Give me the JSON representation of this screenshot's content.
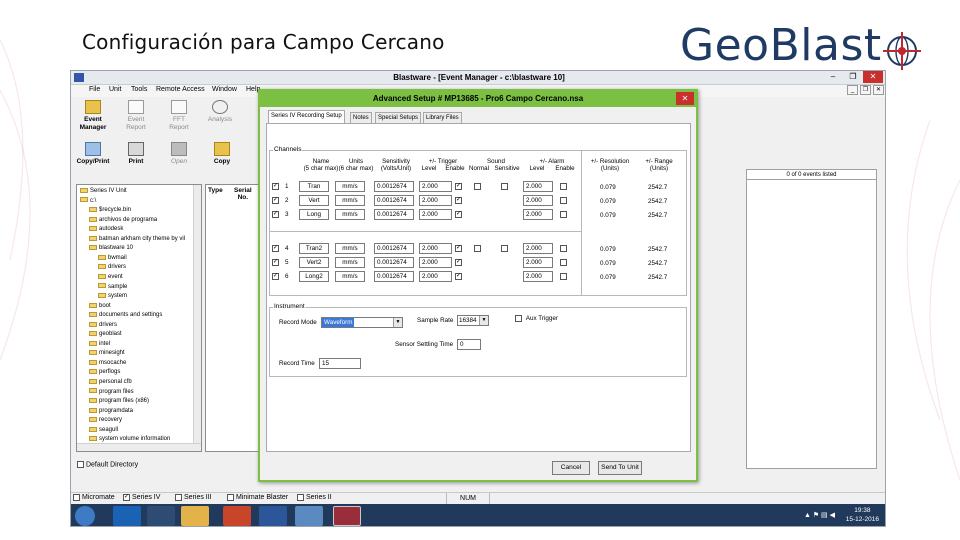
{
  "slide": {
    "title": "Configuración para Campo Cercano",
    "logo_text": "GeoBlast",
    "logo_icon": "globe-crosshair-icon",
    "colors": {
      "logo_blue": "#1f3b63",
      "logo_red": "#c0282d",
      "dialog_green": "#7cc043"
    }
  },
  "app": {
    "title": "Blastware - [Event Manager - c:\\blastware 10]",
    "window_buttons": [
      "–",
      "❐",
      "✕"
    ],
    "inner_buttons": [
      "_",
      "❐",
      "✕"
    ],
    "menu": [
      "File",
      "Unit",
      "Tools",
      "Remote Access",
      "Window",
      "Help"
    ],
    "toolbar_row1": [
      {
        "label": "Event\nManager",
        "icon": "folder-icon",
        "enabled": true
      },
      {
        "label": "Event\nReport",
        "icon": "report-icon",
        "enabled": false
      },
      {
        "label": "FFT\nReport",
        "icon": "fft-icon",
        "enabled": false
      },
      {
        "label": "Analysis",
        "icon": "analysis-icon",
        "enabled": false
      }
    ],
    "toolbar_row2": [
      {
        "label": "Copy/Print",
        "icon": "copy-print-icon",
        "enabled": true
      },
      {
        "label": "Print",
        "icon": "print-icon",
        "enabled": true
      },
      {
        "label": "Open",
        "icon": "open-icon",
        "enabled": false
      },
      {
        "label": "Copy",
        "icon": "copy-icon",
        "enabled": true
      }
    ],
    "tree": [
      {
        "label": "Series IV Unit",
        "level": 0
      },
      {
        "label": "c:\\",
        "level": 0
      },
      {
        "label": "$recycle.bin",
        "level": 1
      },
      {
        "label": "archivos de programa",
        "level": 1
      },
      {
        "label": "autodesk",
        "level": 1
      },
      {
        "label": "batman arkham city theme by vil",
        "level": 1
      },
      {
        "label": "blastware 10",
        "level": 1
      },
      {
        "label": "bwmail",
        "level": 2
      },
      {
        "label": "drivers",
        "level": 2
      },
      {
        "label": "event",
        "level": 2
      },
      {
        "label": "sample",
        "level": 2
      },
      {
        "label": "system",
        "level": 2
      },
      {
        "label": "boot",
        "level": 1
      },
      {
        "label": "documents and settings",
        "level": 1
      },
      {
        "label": "drivers",
        "level": 1
      },
      {
        "label": "geoblast",
        "level": 1
      },
      {
        "label": "intel",
        "level": 1
      },
      {
        "label": "minesight",
        "level": 1
      },
      {
        "label": "msocache",
        "level": 1
      },
      {
        "label": "perflogs",
        "level": 1
      },
      {
        "label": "personal cfb",
        "level": 1
      },
      {
        "label": "program files",
        "level": 1
      },
      {
        "label": "program files (x86)",
        "level": 1
      },
      {
        "label": "programdata",
        "level": 1
      },
      {
        "label": "recovery",
        "level": 1
      },
      {
        "label": "seagull",
        "level": 1
      },
      {
        "label": "system volume information",
        "level": 1
      }
    ],
    "events_header": [
      "Type",
      "Serial\nNo."
    ],
    "events_count": "0 of 0 events listed",
    "default_directory": "Default Directory",
    "status": {
      "items": [
        {
          "label": "Micromate",
          "checked": false
        },
        {
          "label": "Series IV",
          "checked": true
        },
        {
          "label": "Series III",
          "checked": false
        },
        {
          "label": "Minimate Blaster",
          "checked": false
        },
        {
          "label": "Series II",
          "checked": false
        }
      ],
      "num": "NUM"
    },
    "taskbar": {
      "icons": [
        "start-icon",
        "outlook-icon",
        "chrome-icon",
        "explorer-icon",
        "powerpoint-icon",
        "word-icon",
        "app-icon",
        "blastware-icon"
      ],
      "time": "19:38",
      "date": "15-12-2016",
      "tray": "▲ ⚑ ▤ ◀"
    }
  },
  "dialog": {
    "title": "Advanced Setup  # MP13685 - Pro6 Campo Cercano.nsa",
    "close": "✕",
    "tabs": [
      "Series IV Recording Setup",
      "Notes",
      "Special Setups",
      "Library Files"
    ],
    "channels_label": "Channels",
    "headers": {
      "name": "Name\n(5 char max)",
      "units": "Units\n(6 char max)",
      "sensitivity": "Sensitivity\n(Volts/Unit)",
      "trigger": "+/- Trigger",
      "trigger_sub": [
        "Level",
        "Enable"
      ],
      "sound": "Sound",
      "sound_sub": [
        "Normal",
        "Sensitive"
      ],
      "alarm": "+/- Alarm",
      "alarm_sub": [
        "Level",
        "Enable"
      ],
      "resolution": "+/- Resolution\n(Units)",
      "range": "+/- Range\n(Units)"
    },
    "channels": [
      {
        "checked": true,
        "num": "1",
        "name": "Tran",
        "units": "mm/s",
        "sens": "0.0012674",
        "trig": "2.000",
        "trig_en": true,
        "sound": true,
        "alarm": "2.000",
        "res": "0.079",
        "range": "2542.7"
      },
      {
        "checked": true,
        "num": "2",
        "name": "Vert",
        "units": "mm/s",
        "sens": "0.0012674",
        "trig": "2.000",
        "trig_en": true,
        "sound": false,
        "alarm": "2.000",
        "res": "0.079",
        "range": "2542.7"
      },
      {
        "checked": true,
        "num": "3",
        "name": "Long",
        "units": "mm/s",
        "sens": "0.0012674",
        "trig": "2.000",
        "trig_en": true,
        "sound": false,
        "alarm": "2.000",
        "res": "0.079",
        "range": "2542.7"
      },
      {
        "checked": true,
        "num": "4",
        "name": "Tran2",
        "units": "mm/s",
        "sens": "0.0012674",
        "trig": "2.000",
        "trig_en": true,
        "sound": true,
        "alarm": "2.000",
        "res": "0.079",
        "range": "2542.7"
      },
      {
        "checked": true,
        "num": "5",
        "name": "Vert2",
        "units": "mm/s",
        "sens": "0.0012674",
        "trig": "2.000",
        "trig_en": true,
        "sound": false,
        "alarm": "2.000",
        "res": "0.079",
        "range": "2542.7"
      },
      {
        "checked": true,
        "num": "6",
        "name": "Long2",
        "units": "mm/s",
        "sens": "0.0012674",
        "trig": "2.000",
        "trig_en": true,
        "sound": false,
        "alarm": "2.000",
        "res": "0.079",
        "range": "2542.7"
      }
    ],
    "instrument": {
      "label": "Instrument",
      "record_mode_label": "Record Mode",
      "record_mode_value": "Waveform",
      "sample_rate_label": "Sample Rate",
      "sample_rate_value": "16384",
      "aux_trigger_label": "Aux Trigger",
      "sensor_settling_label": "Sensor Settling Time",
      "sensor_settling_value": "0",
      "record_time_label": "Record Time",
      "record_time_value": "15"
    },
    "buttons": {
      "cancel": "Cancel",
      "send": "Send To Unit"
    }
  }
}
